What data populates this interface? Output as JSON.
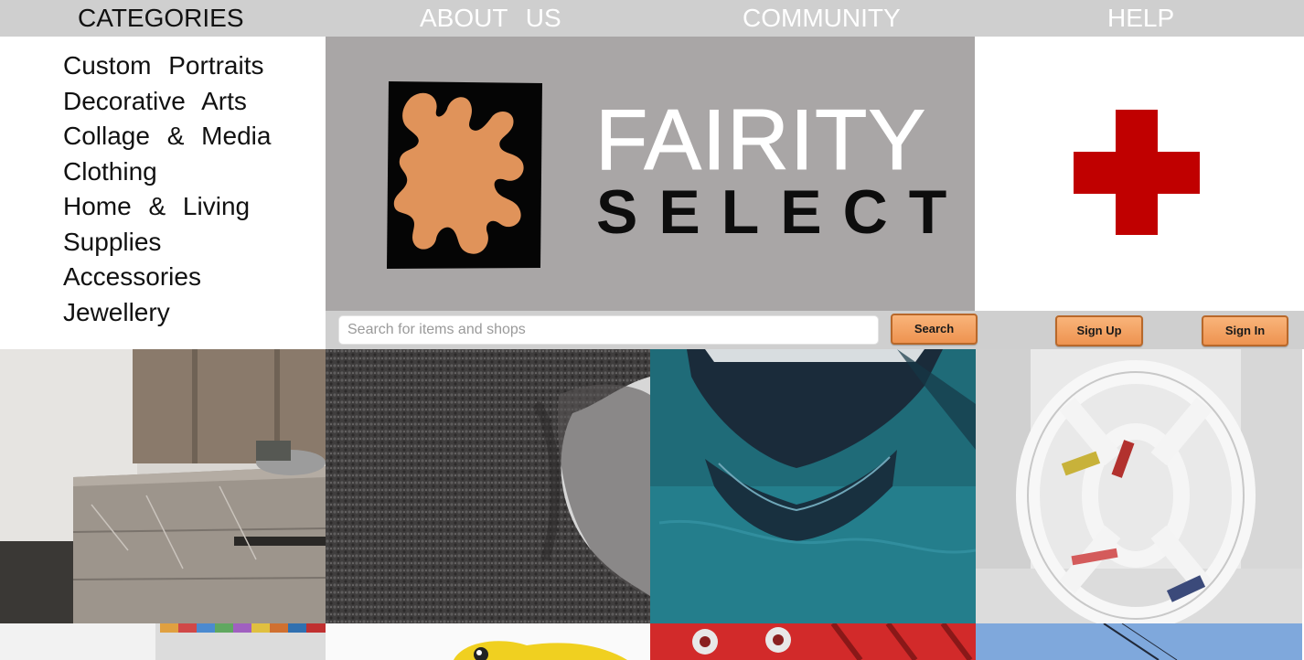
{
  "nav": {
    "categories": "CATEGORIES",
    "about": "ABOUT US",
    "community": "COMMUNITY",
    "help": "HELP"
  },
  "categories": [
    "Custom Portraits",
    "Decorative Arts",
    "Collage & Media",
    "Clothing",
    "Home & Living",
    "Supplies",
    "Accessories",
    "Jewellery"
  ],
  "brand": {
    "line1": "FAIRITY",
    "line2": "SELECT"
  },
  "search": {
    "placeholder": "Search for items and shops",
    "value": "",
    "button_label": "Search"
  },
  "account": {
    "signup_label": "Sign Up",
    "signin_label": "Sign In"
  },
  "icons": {
    "logo": "leaf-silhouette-logo-icon",
    "help": "red-cross-icon"
  },
  "colors": {
    "nav_bg": "#cfcfcf",
    "hero_bg": "#a9a6a6",
    "accent_orange": "#ee9350",
    "cross_red": "#c00000",
    "logo_orange": "#e0935a"
  }
}
